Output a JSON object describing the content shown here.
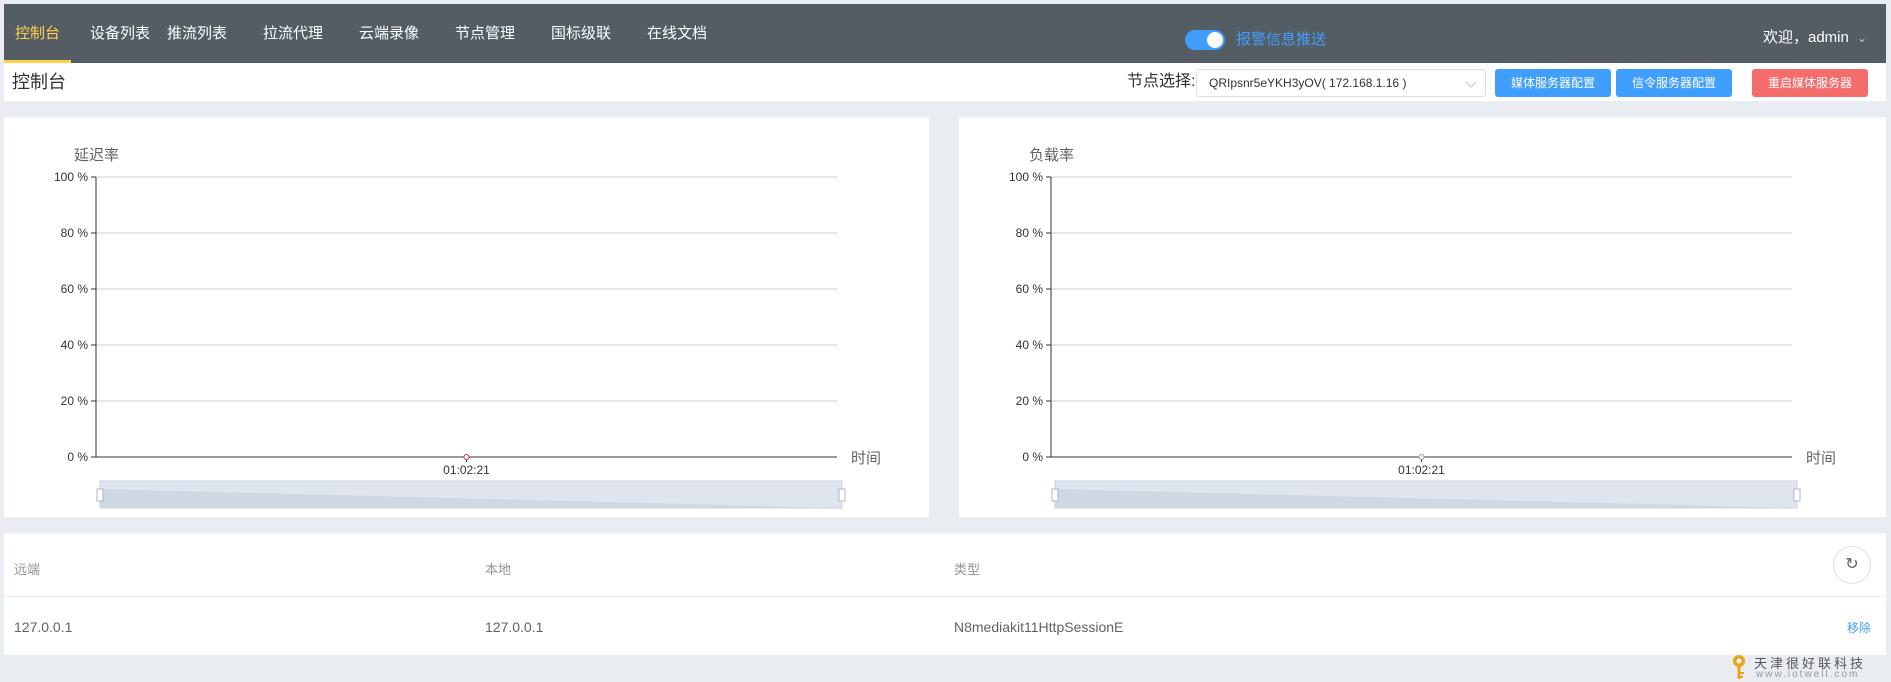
{
  "nav": {
    "items": [
      {
        "label": "控制台",
        "active": true
      },
      {
        "label": "设备列表"
      },
      {
        "label": "推流列表"
      },
      {
        "label": "拉流代理"
      },
      {
        "label": "云端录像"
      },
      {
        "label": "节点管理"
      },
      {
        "label": "国标级联"
      },
      {
        "label": "在线文档"
      }
    ],
    "alarm_toggle": {
      "label": "报警信息推送",
      "on": true
    },
    "welcome": "欢迎，admin"
  },
  "header": {
    "title": "控制台",
    "node_label": "节点选择:",
    "node_value": "QRIpsnr5eYKH3yOV( 172.168.1.16 )",
    "buttons": {
      "media_config": "媒体服务器配置",
      "signal_config": "信令服务器配置",
      "restart_media": "重启媒体服务器"
    }
  },
  "charts": {
    "delay": {
      "title": "延迟率",
      "xlabel": "时间"
    },
    "load": {
      "title": "负载率",
      "xlabel": "时间"
    }
  },
  "chart_data": [
    {
      "type": "line",
      "title": "延迟率",
      "xlabel": "时间",
      "ylabel": "",
      "y_ticks": [
        "100 %",
        "80 %",
        "60 %",
        "40 %",
        "20 %",
        "0 %"
      ],
      "ylim": [
        0,
        100
      ],
      "x": [
        "01:02:21"
      ],
      "series": [
        {
          "values": [
            0
          ],
          "color": "#c23531"
        }
      ],
      "grid": true,
      "datazoom": true
    },
    {
      "type": "line",
      "title": "负载率",
      "xlabel": "时间",
      "ylabel": "",
      "y_ticks": [
        "100 %",
        "80 %",
        "60 %",
        "40 %",
        "20 %",
        "0 %"
      ],
      "ylim": [
        0,
        100
      ],
      "x": [
        "01:02:21"
      ],
      "series": [
        {
          "values": [
            0
          ],
          "color": "#999999"
        }
      ],
      "grid": true,
      "datazoom": true
    }
  ],
  "table": {
    "columns": [
      "远端",
      "本地",
      "类型"
    ],
    "rows": [
      {
        "remote": "127.0.0.1",
        "local": "127.0.0.1",
        "type": "N8mediakit11HttpSessionE",
        "action": "移除"
      }
    ]
  },
  "watermark": {
    "text": "天津很好联科技",
    "url": "www.iotwell.com"
  }
}
